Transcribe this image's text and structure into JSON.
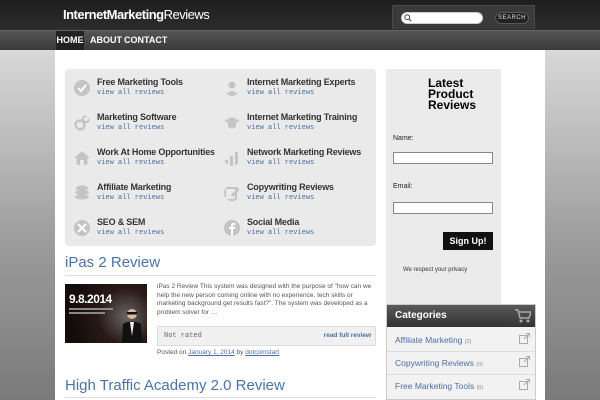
{
  "header": {
    "logo_part1": "Internet",
    "logo_part2": "Marketing",
    "logo_part3": "Reviews",
    "search_placeholder": "",
    "search_button": "SEARCH"
  },
  "nav": {
    "home": "HOME",
    "about": "ABOUT",
    "contact": "CONTACT"
  },
  "categories": [
    {
      "title": "Free Marketing Tools",
      "link": "view all reviews",
      "icon": "check-circle-icon"
    },
    {
      "title": "Internet Marketing Experts",
      "link": "view all reviews",
      "icon": "user-icon"
    },
    {
      "title": "Marketing Software",
      "link": "view all reviews",
      "icon": "gears-icon"
    },
    {
      "title": "Internet Marketing Training",
      "link": "view all reviews",
      "icon": "graduation-cap-icon"
    },
    {
      "title": "Work At Home Opportunities",
      "link": "view all reviews",
      "icon": "home-icon"
    },
    {
      "title": "Network Marketing Reviews",
      "link": "view all reviews",
      "icon": "bar-chart-icon"
    },
    {
      "title": "Affiliate Marketing",
      "link": "view all reviews",
      "icon": "coins-icon"
    },
    {
      "title": "Copywriting Reviews",
      "link": "view all reviews",
      "icon": "pencil-icon"
    },
    {
      "title": "SEO & SEM",
      "link": "view all reviews",
      "icon": "tools-icon"
    },
    {
      "title": "Social Media",
      "link": "view all reviews",
      "icon": "facebook-icon"
    }
  ],
  "posts": [
    {
      "title": "iPas 2 Review",
      "thumb_date": "9.8.2014",
      "excerpt": "iPas 2 Review This system was designed with the purpose of \"how can we help the new person coming online with no experience, tech skills or marketing background get results fast?\". The system was developed as a problem solver for …",
      "rating": "Not rated",
      "read_more": "read full review",
      "posted_prefix": "Posted on",
      "date": "January 1, 2014",
      "by": "by",
      "author": "dotcomstart"
    },
    {
      "title": "High Traffic Academy 2.0 Review"
    }
  ],
  "signup": {
    "title": "Latest Product Reviews",
    "name_label": "Name:",
    "email_label": "Email:",
    "button": "Sign Up!",
    "privacy": "We respect your privacy"
  },
  "sidebar_categories": {
    "heading": "Categories",
    "items": [
      {
        "label": "Affiliate Marketing",
        "count": "(2)"
      },
      {
        "label": "Copywriting Reviews",
        "count": "(0)"
      },
      {
        "label": "Free Marketing Tools",
        "count": "(0)"
      }
    ]
  }
}
